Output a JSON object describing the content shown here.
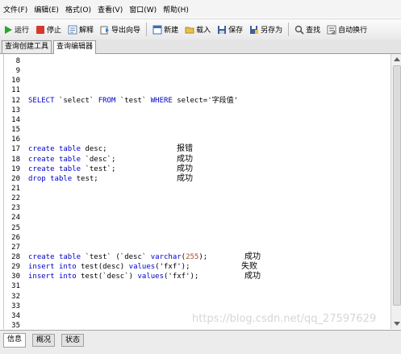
{
  "menu": [
    "文件(F)",
    "编辑(E)",
    "格式(O)",
    "查看(V)",
    "窗口(W)",
    "帮助(H)"
  ],
  "toolbar": {
    "run": "运行",
    "stop": "停止",
    "explain": "解释",
    "export_wizard": "导出向导",
    "new": "新建",
    "load": "载入",
    "save": "保存",
    "save_as": "另存为",
    "find": "查找",
    "word_wrap": "自动换行"
  },
  "tabs": [
    "查询创建工具",
    "查询编辑器"
  ],
  "editor": {
    "lines": [
      {
        "no": "8",
        "code": ""
      },
      {
        "no": "9",
        "code": ""
      },
      {
        "no": "10",
        "code": ""
      },
      {
        "no": "11",
        "code": ""
      },
      {
        "no": "12",
        "code": "SELECT `select` FROM `test` WHERE select='字段值'"
      },
      {
        "no": "13",
        "code": ""
      },
      {
        "no": "14",
        "code": ""
      },
      {
        "no": "15",
        "code": ""
      },
      {
        "no": "16",
        "code": ""
      },
      {
        "no": "17",
        "code": "create table desc;"
      },
      {
        "no": "18",
        "code": "create table `desc`;"
      },
      {
        "no": "19",
        "code": "create table `test`;"
      },
      {
        "no": "20",
        "code": "drop table test;"
      },
      {
        "no": "21",
        "code": ""
      },
      {
        "no": "22",
        "code": ""
      },
      {
        "no": "23",
        "code": ""
      },
      {
        "no": "24",
        "code": ""
      },
      {
        "no": "25",
        "code": ""
      },
      {
        "no": "26",
        "code": ""
      },
      {
        "no": "27",
        "code": ""
      },
      {
        "no": "28",
        "code": "create table `test` (`desc` varchar(255);"
      },
      {
        "no": "29",
        "code": "insert into test(desc) values('fxf');"
      },
      {
        "no": "30",
        "code": "insert into test(`desc`) values('fxf');"
      },
      {
        "no": "31",
        "code": ""
      },
      {
        "no": "32",
        "code": ""
      },
      {
        "no": "33",
        "code": ""
      },
      {
        "no": "34",
        "code": ""
      },
      {
        "no": "35",
        "code": ""
      }
    ],
    "results": [
      {
        "line": "17",
        "text": "报错"
      },
      {
        "line": "18",
        "text": "成功"
      },
      {
        "line": "19",
        "text": "成功"
      },
      {
        "line": "20",
        "text": "成功"
      },
      {
        "line": "28",
        "text": "成功"
      },
      {
        "line": "29",
        "text": "失败"
      },
      {
        "line": "30",
        "text": "成功"
      }
    ]
  },
  "bottom_tabs": [
    "信息",
    "概况",
    "状态"
  ],
  "watermark": "https://blog.csdn.net/qq_27597629",
  "colors": {
    "keyword": "#0000cc",
    "number": "#a0522d"
  }
}
